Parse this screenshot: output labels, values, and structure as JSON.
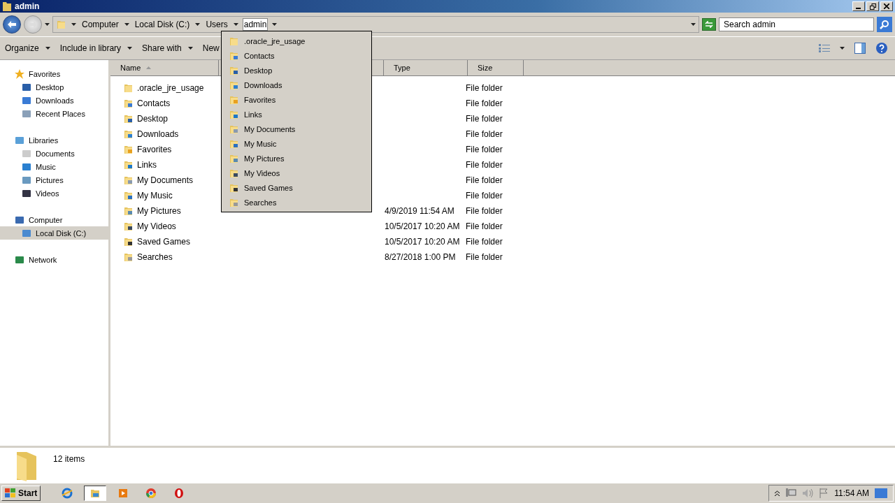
{
  "window": {
    "title": "admin"
  },
  "address": {
    "crumbs": [
      {
        "label": "Computer",
        "selected": false
      },
      {
        "label": "Local Disk (C:)",
        "selected": false
      },
      {
        "label": "Users",
        "selected": false
      },
      {
        "label": "admin",
        "selected": true
      }
    ]
  },
  "search": {
    "placeholder": "Search admin"
  },
  "toolbar": [
    {
      "label": "Organize",
      "menu": true
    },
    {
      "label": "Include in library",
      "menu": true
    },
    {
      "label": "Share with",
      "menu": true
    },
    {
      "label": "New",
      "menu": false
    }
  ],
  "sidebar": {
    "groups": [
      {
        "label": "Favorites",
        "selected": false,
        "children": [
          {
            "label": "Desktop",
            "selected": false
          },
          {
            "label": "Downloads",
            "selected": false
          },
          {
            "label": "Recent Places",
            "selected": false
          }
        ]
      },
      {
        "label": "Libraries",
        "selected": false,
        "children": [
          {
            "label": "Documents",
            "selected": false
          },
          {
            "label": "Music",
            "selected": false
          },
          {
            "label": "Pictures",
            "selected": false
          },
          {
            "label": "Videos",
            "selected": false
          }
        ]
      },
      {
        "label": "Computer",
        "selected": false,
        "children": [
          {
            "label": "Local Disk (C:)",
            "selected": true
          }
        ]
      },
      {
        "label": "Network",
        "selected": false
      }
    ]
  },
  "table": {
    "columns": [
      {
        "label": "Name",
        "sorted": true
      },
      {
        "label": "Type",
        "sorted": false
      },
      {
        "label": "Size",
        "sorted": false
      }
    ],
    "rows": [
      {
        "name": ".oracle_jre_usage",
        "type": "File folder"
      },
      {
        "name": "Contacts",
        "type": "File folder"
      },
      {
        "name": "Desktop",
        "type": "File folder"
      },
      {
        "name": "Downloads",
        "type": "File folder"
      },
      {
        "name": "Favorites",
        "type": "File folder"
      },
      {
        "name": "Links",
        "type": "File folder"
      },
      {
        "name": "My Documents",
        "type": "File folder"
      },
      {
        "name": "My Music",
        "type": "File folder"
      },
      {
        "name": "My Pictures",
        "date": "4/9/2019 11:54 AM",
        "type": "File folder"
      },
      {
        "name": "My Videos",
        "date": "10/5/2017 10:20 AM",
        "type": "File folder"
      },
      {
        "name": "Saved Games",
        "date": "10/5/2017 10:20 AM",
        "type": "File folder"
      },
      {
        "name": "Searches",
        "date": "8/27/2018 1:00 PM",
        "type": "File folder"
      }
    ]
  },
  "dropdown": {
    "items": [
      ".oracle_jre_usage",
      "Contacts",
      "Desktop",
      "Downloads",
      "Favorites",
      "Links",
      "My Documents",
      "My Music",
      "My Pictures",
      "My Videos",
      "Saved Games",
      "Searches"
    ]
  },
  "status_bar": {
    "count": "12 items"
  },
  "taskbar": {
    "start": "Start",
    "apps": [
      {
        "selected": false
      },
      {
        "selected": true
      },
      {
        "selected": false
      },
      {
        "selected": false
      },
      {
        "selected": false
      }
    ],
    "clock": "11:54 AM"
  }
}
